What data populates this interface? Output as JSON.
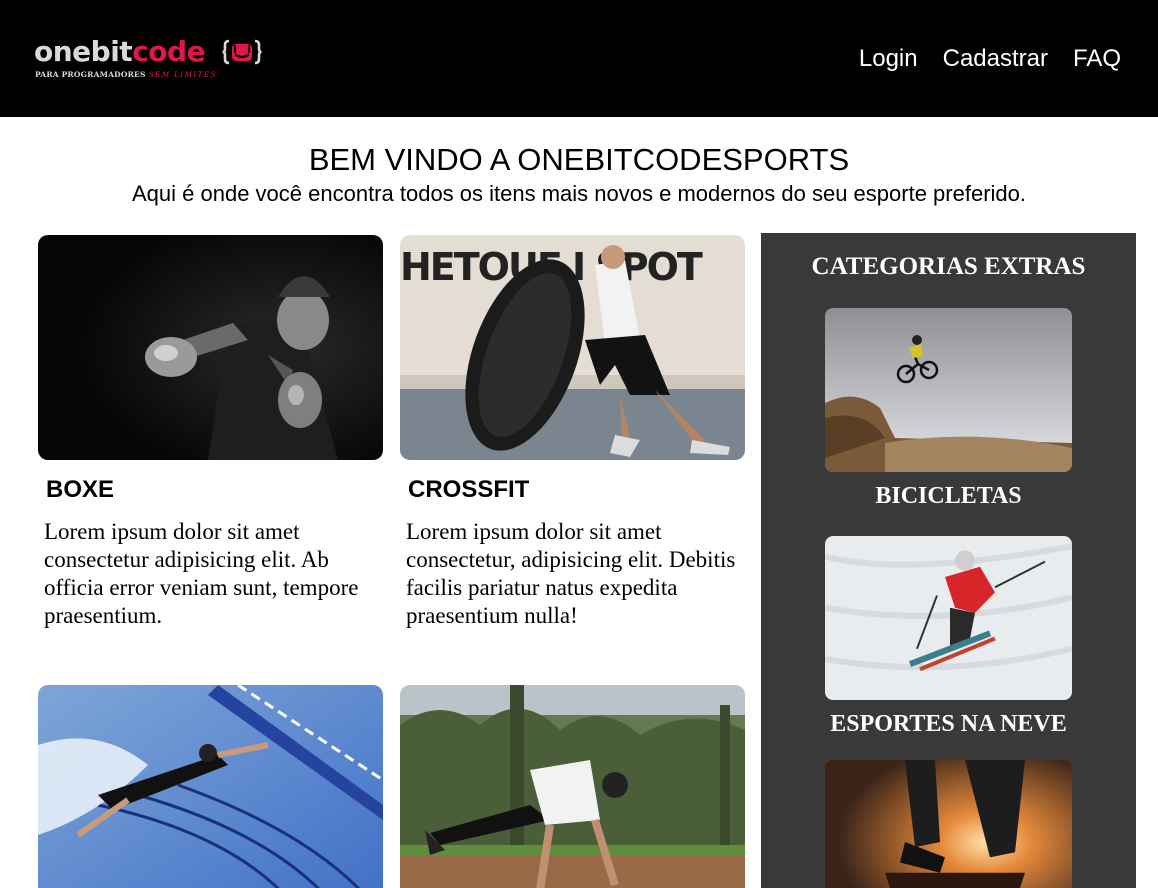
{
  "header": {
    "logo": {
      "word_one": "onebit",
      "word_two": "code",
      "tagline_main": "PARA PROGRAMADORES",
      "tagline_accent": "SEM LIMITES"
    },
    "nav": [
      {
        "label": "Login"
      },
      {
        "label": "Cadastrar"
      },
      {
        "label": "FAQ"
      }
    ]
  },
  "welcome": {
    "title": "BEM VINDO A ONEBITCODESPORTS",
    "subtitle": "Aqui é onde você encontra todos os itens mais novos e modernos do seu esporte preferido."
  },
  "cards": [
    {
      "title": "BOXE",
      "text": "Lorem ipsum dolor sit amet consectetur adipisicing elit. Ab officia error veniam sunt, tempore praesentium.",
      "image": "boxing-photo"
    },
    {
      "title": "CROSSFIT",
      "text": "Lorem ipsum dolor sit amet consectetur, adipisicing elit. Debitis facilis pariatur natus expedita praesentium nulla!",
      "image": "crossfit-photo"
    },
    {
      "title": "",
      "text": "",
      "image": "swimming-photo"
    },
    {
      "title": "",
      "text": "",
      "image": "calisthenics-photo"
    }
  ],
  "sidebar": {
    "title": "CATEGORIAS EXTRAS",
    "items": [
      {
        "label": "BICICLETAS",
        "image": "mountain-bike-photo"
      },
      {
        "label": "ESPORTES NA NEVE",
        "image": "skiing-photo"
      },
      {
        "label": "",
        "image": "skateboard-photo"
      }
    ]
  },
  "colors": {
    "header_bg": "#000000",
    "brand_accent": "#e0184a",
    "sidebar_bg": "#393939"
  }
}
